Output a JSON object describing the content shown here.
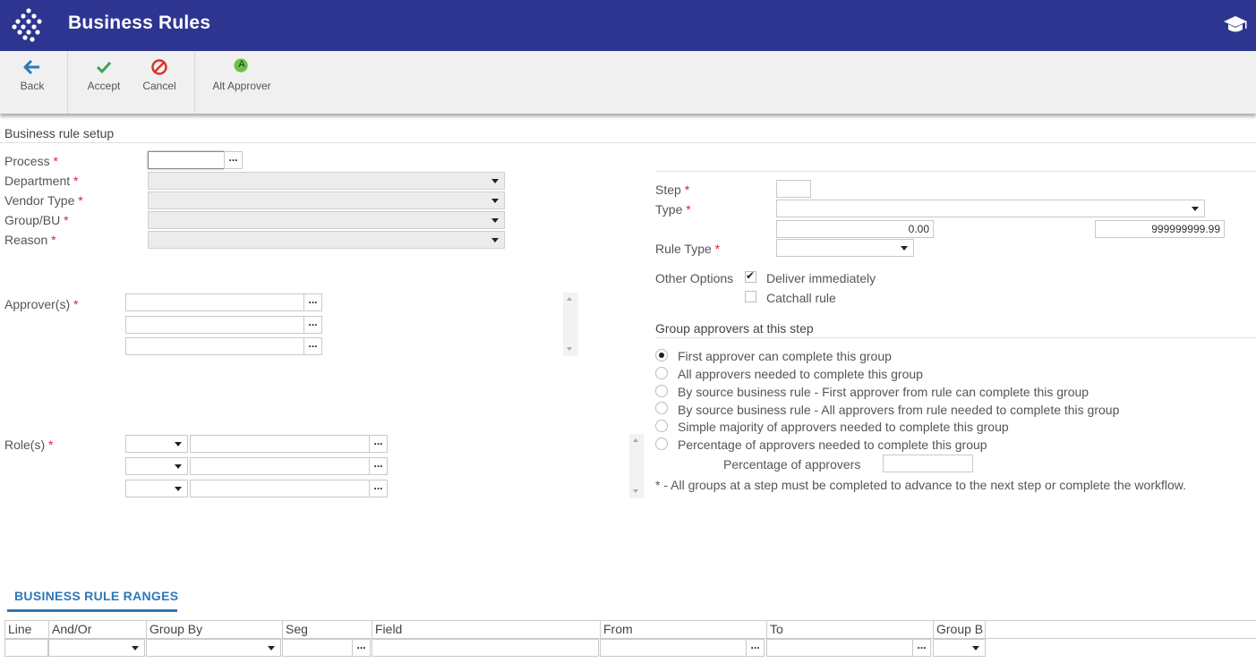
{
  "header": {
    "title": "Business Rules",
    "logo_icon": "diamond-dots-logo",
    "help_icon": "graduation-cap-icon",
    "bg_color": "#2e3591"
  },
  "toolbar": {
    "back": "Back",
    "accept": "Accept",
    "cancel": "Cancel",
    "alt_approver": "Alt Approver",
    "alt_approver_badge": "A"
  },
  "setup": {
    "section_title": "Business rule setup",
    "process_label": "Process",
    "department_label": "Department",
    "vendor_type_label": "Vendor Type",
    "group_bu_label": "Group/BU",
    "reason_label": "Reason",
    "approvers_label": "Approver(s)",
    "roles_label": "Role(s)",
    "required_mark": "*",
    "ellipsis": "..."
  },
  "step": {
    "step_label": "Step",
    "type_label": "Type",
    "range_from": "0.00",
    "range_to": "999999999.99",
    "rule_type_label": "Rule Type",
    "other_options_label": "Other Options",
    "deliver_immediately": "Deliver immediately",
    "deliver_immediately_checked": true,
    "catchall_rule": "Catchall rule",
    "catchall_rule_checked": false,
    "check_mark": "✔"
  },
  "group_approvers": {
    "title": "Group approvers at this step",
    "options": [
      "First approver can complete this group",
      "All approvers needed to complete this group",
      "By source business rule - First approver from rule can complete this group",
      "By source business rule - All approvers from rule needed to complete this group",
      "Simple majority of approvers needed to complete this group",
      "Percentage of approvers needed to complete this group"
    ],
    "selected_index": 0,
    "percentage_label": "Percentage of approvers",
    "footnote": "* - All groups at a step must be completed to advance to the next step or complete the workflow."
  },
  "ranges": {
    "tab_title": "BUSINESS RULE RANGES",
    "accent_color": "#2f77b8",
    "columns": [
      "Line",
      "And/Or",
      "Group By",
      "Seg",
      "Field",
      "From",
      "To",
      "Group B"
    ]
  }
}
